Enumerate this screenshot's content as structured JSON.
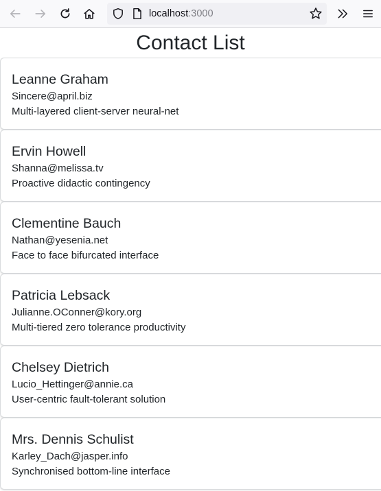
{
  "browser": {
    "url_host": "localhost",
    "url_port": ":3000",
    "icons": {
      "back": "arrow-left-icon",
      "forward": "arrow-right-icon",
      "reload": "reload-icon",
      "home": "home-icon",
      "shield": "shield-icon",
      "page": "page-icon",
      "bookmark": "star-icon",
      "overflow": "chevron-double-right-icon",
      "menu": "hamburger-menu-icon"
    },
    "colors": {
      "toolbar_bg": "#f9f9fb",
      "urlbar_bg": "#f0f0f4",
      "icon": "#15141a",
      "icon_disabled": "#b4b4b8"
    }
  },
  "page": {
    "title": "Contact List"
  },
  "contacts": [
    {
      "name": "Leanne Graham",
      "email": "Sincere@april.biz",
      "phrase": "Multi-layered client-server neural-net"
    },
    {
      "name": "Ervin Howell",
      "email": "Shanna@melissa.tv",
      "phrase": "Proactive didactic contingency"
    },
    {
      "name": "Clementine Bauch",
      "email": "Nathan@yesenia.net",
      "phrase": "Face to face bifurcated interface"
    },
    {
      "name": "Patricia Lebsack",
      "email": "Julianne.OConner@kory.org",
      "phrase": "Multi-tiered zero tolerance productivity"
    },
    {
      "name": "Chelsey Dietrich",
      "email": "Lucio_Hettinger@annie.ca",
      "phrase": "User-centric fault-tolerant solution"
    },
    {
      "name": "Mrs. Dennis Schulist",
      "email": "Karley_Dach@jasper.info",
      "phrase": "Synchronised bottom-line interface"
    }
  ]
}
